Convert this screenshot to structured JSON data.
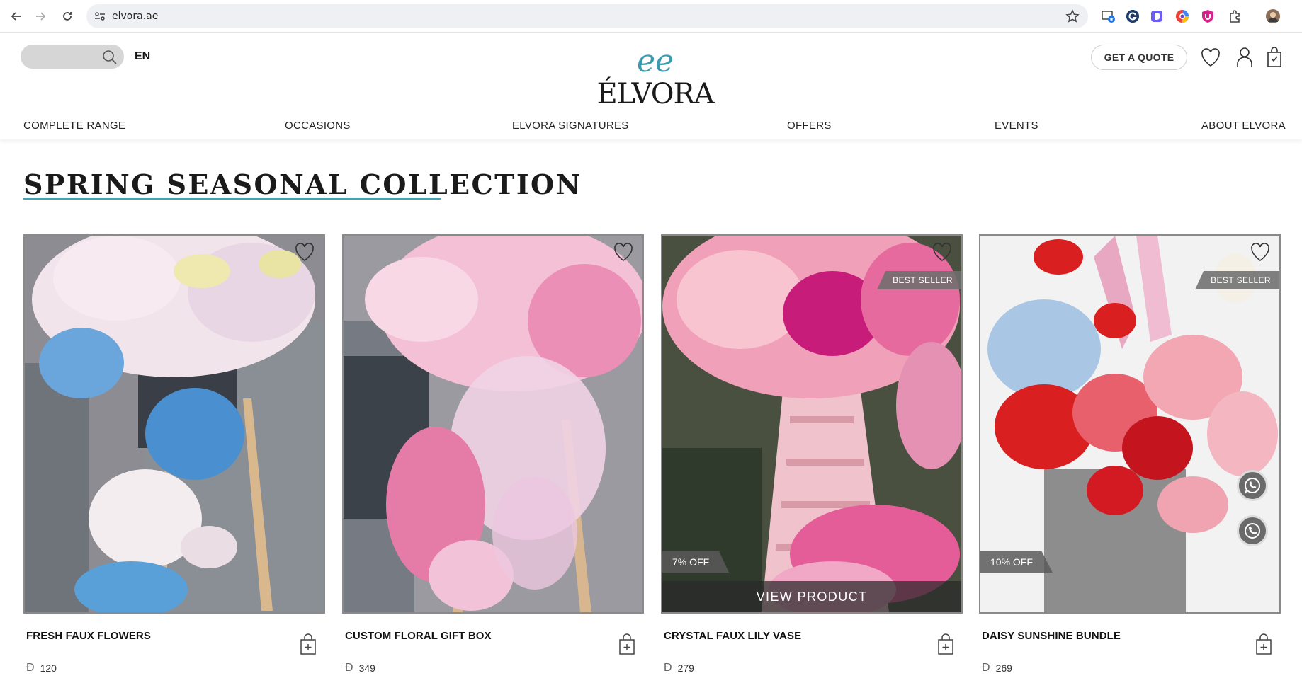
{
  "browser": {
    "url": "elvora.ae"
  },
  "header": {
    "language": "EN",
    "logo_monogram": "ee",
    "logo_text": "ÉLVORA",
    "quote_button": "GET A QUOTE"
  },
  "nav": {
    "items": [
      "COMPLETE RANGE",
      "OCCASIONS",
      "ELVORA SIGNATURES",
      "OFFERS",
      "EVENTS",
      "ABOUT ELVORA"
    ]
  },
  "section": {
    "title": "SPRING SEASONAL COLLECTION"
  },
  "currency_symbol": "Đ",
  "products": [
    {
      "name": "FRESH FAUX FLOWERS",
      "price": "120",
      "badge": "",
      "discount": "",
      "overlay": ""
    },
    {
      "name": "CUSTOM FLORAL GIFT BOX",
      "price": "349",
      "badge": "",
      "discount": "",
      "overlay": ""
    },
    {
      "name": "CRYSTAL FAUX LILY VASE",
      "price": "279",
      "badge": "BEST SELLER",
      "discount": "7% OFF",
      "overlay": "VIEW PRODUCT"
    },
    {
      "name": "DAISY SUNSHINE BUNDLE",
      "price": "269",
      "badge": "BEST SELLER",
      "discount": "10% OFF",
      "overlay": ""
    }
  ],
  "colors": {
    "accent": "#3fa6b8",
    "badge_bg": "#6e6e6e",
    "text": "#111111"
  }
}
